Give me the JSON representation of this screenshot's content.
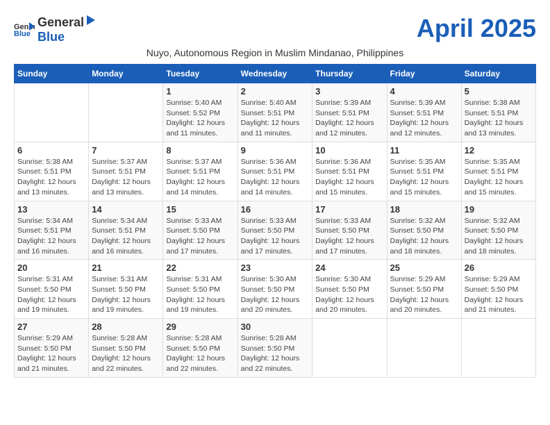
{
  "header": {
    "logo_general": "General",
    "logo_blue": "Blue",
    "month_title": "April 2025",
    "subtitle": "Nuyo, Autonomous Region in Muslim Mindanao, Philippines"
  },
  "days_of_week": [
    "Sunday",
    "Monday",
    "Tuesday",
    "Wednesday",
    "Thursday",
    "Friday",
    "Saturday"
  ],
  "weeks": [
    [
      {
        "day": "",
        "info": ""
      },
      {
        "day": "",
        "info": ""
      },
      {
        "day": "1",
        "info": "Sunrise: 5:40 AM\nSunset: 5:52 PM\nDaylight: 12 hours and 11 minutes."
      },
      {
        "day": "2",
        "info": "Sunrise: 5:40 AM\nSunset: 5:51 PM\nDaylight: 12 hours and 11 minutes."
      },
      {
        "day": "3",
        "info": "Sunrise: 5:39 AM\nSunset: 5:51 PM\nDaylight: 12 hours and 12 minutes."
      },
      {
        "day": "4",
        "info": "Sunrise: 5:39 AM\nSunset: 5:51 PM\nDaylight: 12 hours and 12 minutes."
      },
      {
        "day": "5",
        "info": "Sunrise: 5:38 AM\nSunset: 5:51 PM\nDaylight: 12 hours and 13 minutes."
      }
    ],
    [
      {
        "day": "6",
        "info": "Sunrise: 5:38 AM\nSunset: 5:51 PM\nDaylight: 12 hours and 13 minutes."
      },
      {
        "day": "7",
        "info": "Sunrise: 5:37 AM\nSunset: 5:51 PM\nDaylight: 12 hours and 13 minutes."
      },
      {
        "day": "8",
        "info": "Sunrise: 5:37 AM\nSunset: 5:51 PM\nDaylight: 12 hours and 14 minutes."
      },
      {
        "day": "9",
        "info": "Sunrise: 5:36 AM\nSunset: 5:51 PM\nDaylight: 12 hours and 14 minutes."
      },
      {
        "day": "10",
        "info": "Sunrise: 5:36 AM\nSunset: 5:51 PM\nDaylight: 12 hours and 15 minutes."
      },
      {
        "day": "11",
        "info": "Sunrise: 5:35 AM\nSunset: 5:51 PM\nDaylight: 12 hours and 15 minutes."
      },
      {
        "day": "12",
        "info": "Sunrise: 5:35 AM\nSunset: 5:51 PM\nDaylight: 12 hours and 15 minutes."
      }
    ],
    [
      {
        "day": "13",
        "info": "Sunrise: 5:34 AM\nSunset: 5:51 PM\nDaylight: 12 hours and 16 minutes."
      },
      {
        "day": "14",
        "info": "Sunrise: 5:34 AM\nSunset: 5:51 PM\nDaylight: 12 hours and 16 minutes."
      },
      {
        "day": "15",
        "info": "Sunrise: 5:33 AM\nSunset: 5:50 PM\nDaylight: 12 hours and 17 minutes."
      },
      {
        "day": "16",
        "info": "Sunrise: 5:33 AM\nSunset: 5:50 PM\nDaylight: 12 hours and 17 minutes."
      },
      {
        "day": "17",
        "info": "Sunrise: 5:33 AM\nSunset: 5:50 PM\nDaylight: 12 hours and 17 minutes."
      },
      {
        "day": "18",
        "info": "Sunrise: 5:32 AM\nSunset: 5:50 PM\nDaylight: 12 hours and 18 minutes."
      },
      {
        "day": "19",
        "info": "Sunrise: 5:32 AM\nSunset: 5:50 PM\nDaylight: 12 hours and 18 minutes."
      }
    ],
    [
      {
        "day": "20",
        "info": "Sunrise: 5:31 AM\nSunset: 5:50 PM\nDaylight: 12 hours and 19 minutes."
      },
      {
        "day": "21",
        "info": "Sunrise: 5:31 AM\nSunset: 5:50 PM\nDaylight: 12 hours and 19 minutes."
      },
      {
        "day": "22",
        "info": "Sunrise: 5:31 AM\nSunset: 5:50 PM\nDaylight: 12 hours and 19 minutes."
      },
      {
        "day": "23",
        "info": "Sunrise: 5:30 AM\nSunset: 5:50 PM\nDaylight: 12 hours and 20 minutes."
      },
      {
        "day": "24",
        "info": "Sunrise: 5:30 AM\nSunset: 5:50 PM\nDaylight: 12 hours and 20 minutes."
      },
      {
        "day": "25",
        "info": "Sunrise: 5:29 AM\nSunset: 5:50 PM\nDaylight: 12 hours and 20 minutes."
      },
      {
        "day": "26",
        "info": "Sunrise: 5:29 AM\nSunset: 5:50 PM\nDaylight: 12 hours and 21 minutes."
      }
    ],
    [
      {
        "day": "27",
        "info": "Sunrise: 5:29 AM\nSunset: 5:50 PM\nDaylight: 12 hours and 21 minutes."
      },
      {
        "day": "28",
        "info": "Sunrise: 5:28 AM\nSunset: 5:50 PM\nDaylight: 12 hours and 22 minutes."
      },
      {
        "day": "29",
        "info": "Sunrise: 5:28 AM\nSunset: 5:50 PM\nDaylight: 12 hours and 22 minutes."
      },
      {
        "day": "30",
        "info": "Sunrise: 5:28 AM\nSunset: 5:50 PM\nDaylight: 12 hours and 22 minutes."
      },
      {
        "day": "",
        "info": ""
      },
      {
        "day": "",
        "info": ""
      },
      {
        "day": "",
        "info": ""
      }
    ]
  ]
}
